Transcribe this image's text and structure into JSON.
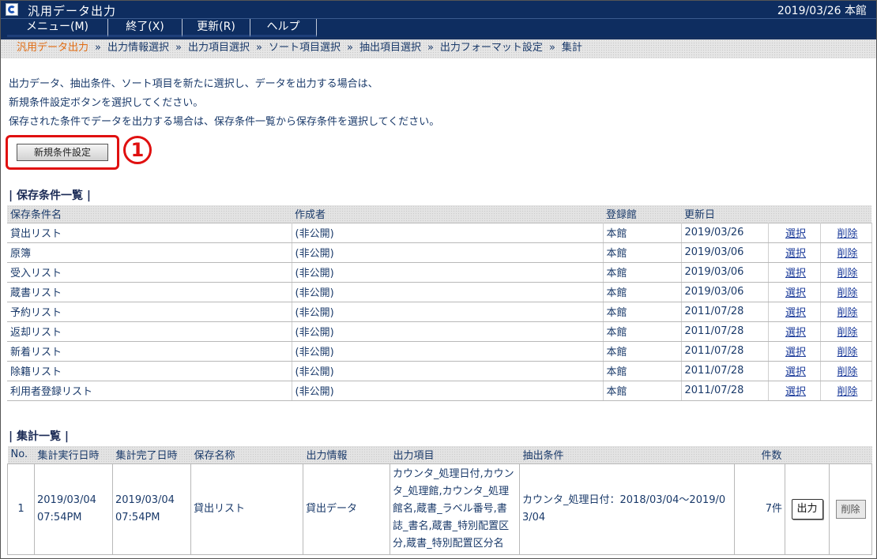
{
  "window": {
    "title": "汎用データ出力",
    "date_location": "2019/03/26 本館"
  },
  "menu": [
    {
      "label": "メニュー(M)"
    },
    {
      "label": "終了(X)"
    },
    {
      "label": "更新(R)"
    },
    {
      "label": "ヘルプ"
    }
  ],
  "breadcrumb": {
    "separator": "»",
    "items": [
      "汎用データ出力",
      "出力情報選択",
      "出力項目選択",
      "ソート項目選択",
      "抽出項目選択",
      "出力フォーマット設定",
      "集計"
    ]
  },
  "instructions": [
    "出力データ、抽出条件、ソート項目を新たに選択し、データを出力する場合は、",
    "新規条件設定ボタンを選択してください。",
    "保存された条件でデータを出力する場合は、保存条件一覧から保存条件を選択してください。"
  ],
  "new_button": {
    "label": "新規条件設定",
    "marker": "1"
  },
  "saved_conditions": {
    "title": "| 保存条件一覧 |",
    "headers": {
      "name": "保存条件名",
      "creator": "作成者",
      "library": "登録館",
      "updated": "更新日"
    },
    "select_label": "選択",
    "delete_label": "削除",
    "rows": [
      {
        "name": "貸出リスト",
        "creator": "(非公開)",
        "library": "本館",
        "updated": "2019/03/26"
      },
      {
        "name": "原簿",
        "creator": "(非公開)",
        "library": "本館",
        "updated": "2019/03/06"
      },
      {
        "name": "受入リスト",
        "creator": "(非公開)",
        "library": "本館",
        "updated": "2019/03/06"
      },
      {
        "name": "蔵書リスト",
        "creator": "(非公開)",
        "library": "本館",
        "updated": "2019/03/06"
      },
      {
        "name": "予約リスト",
        "creator": "(非公開)",
        "library": "本館",
        "updated": "2011/07/28"
      },
      {
        "name": "返却リスト",
        "creator": "(非公開)",
        "library": "本館",
        "updated": "2011/07/28"
      },
      {
        "name": "新着リスト",
        "creator": "(非公開)",
        "library": "本館",
        "updated": "2011/07/28"
      },
      {
        "name": "除籍リスト",
        "creator": "(非公開)",
        "library": "本館",
        "updated": "2011/07/28"
      },
      {
        "name": "利用者登録リスト",
        "creator": "(非公開)",
        "library": "本館",
        "updated": "2011/07/28"
      }
    ]
  },
  "aggregations": {
    "title": "| 集計一覧 |",
    "headers": {
      "no": "No.",
      "exec_start": "集計実行日時",
      "exec_end": "集計完了日時",
      "save_name": "保存名称",
      "output_info": "出力情報",
      "output_items": "出力項目",
      "extract_cond": "抽出条件",
      "count": "件数"
    },
    "rows": [
      {
        "no": "1",
        "exec_start_date": "2019/03/04",
        "exec_start_time": "07:54PM",
        "exec_end_date": "2019/03/04",
        "exec_end_time": "07:54PM",
        "save_name": "貸出リスト",
        "output_info": "貸出データ",
        "output_items": "カウンタ_処理日付,カウンタ_処理館,カウンタ_処理館名,蔵書_ラベル番号,書誌_書名,蔵書_特別配置区分,蔵書_特別配置区分名",
        "extract_cond": "カウンタ_処理日付：2018/03/04～2019/03/04",
        "count": "7件",
        "output_label": "出力",
        "delete_label": "削除"
      }
    ]
  }
}
